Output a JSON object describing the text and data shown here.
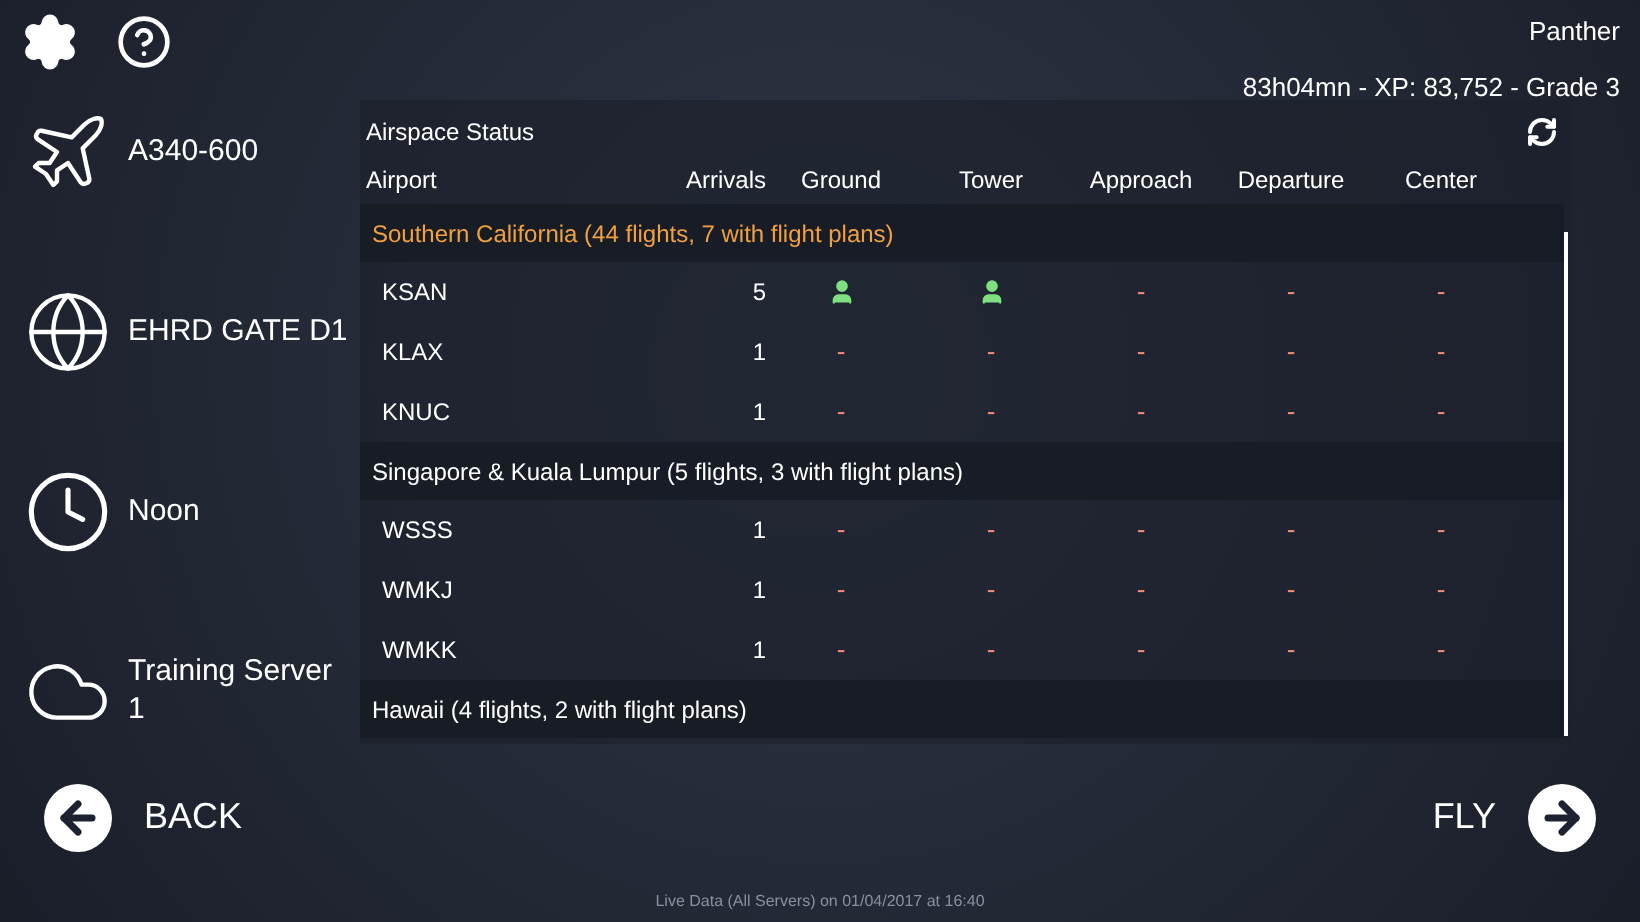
{
  "user": {
    "name": "Panther",
    "stats": "83h04mn - XP: 83,752 - Grade 3"
  },
  "sidebar": [
    {
      "kind": "aircraft",
      "label": "A340-600"
    },
    {
      "kind": "location",
      "label": "EHRD GATE D1"
    },
    {
      "kind": "time",
      "label": "Noon"
    },
    {
      "kind": "server",
      "label": "Training Server 1"
    }
  ],
  "panel": {
    "title": "Airspace Status",
    "columns": [
      "Airport",
      "Arrivals",
      "Ground",
      "Tower",
      "Approach",
      "Departure",
      "Center"
    ],
    "regions": [
      {
        "label": "Southern California (44 flights, 7 with flight plans)",
        "selected": true,
        "airports": [
          {
            "code": "KSAN",
            "arrivals": "5",
            "cells": [
              {
                "kind": "controller"
              },
              {
                "kind": "controller"
              },
              {
                "kind": "dash",
                "text": "-"
              },
              {
                "kind": "dash",
                "text": "-"
              },
              {
                "kind": "dash",
                "text": "-"
              }
            ]
          },
          {
            "code": "KLAX",
            "arrivals": "1",
            "cells": [
              {
                "kind": "dash",
                "text": "-"
              },
              {
                "kind": "dash",
                "text": "-"
              },
              {
                "kind": "dash",
                "text": "-"
              },
              {
                "kind": "dash",
                "text": "-"
              },
              {
                "kind": "dash",
                "text": "-"
              }
            ]
          },
          {
            "code": "KNUC",
            "arrivals": "1",
            "cells": [
              {
                "kind": "dash",
                "text": "-"
              },
              {
                "kind": "dash",
                "text": "-"
              },
              {
                "kind": "dash",
                "text": "-"
              },
              {
                "kind": "dash",
                "text": "-"
              },
              {
                "kind": "dash",
                "text": "-"
              }
            ]
          }
        ]
      },
      {
        "label": "Singapore & Kuala Lumpur (5 flights, 3 with flight plans)",
        "selected": false,
        "airports": [
          {
            "code": "WSSS",
            "arrivals": "1",
            "cells": [
              {
                "kind": "dash",
                "text": "-"
              },
              {
                "kind": "dash",
                "text": "-"
              },
              {
                "kind": "dash",
                "text": "-"
              },
              {
                "kind": "dash",
                "text": "-"
              },
              {
                "kind": "dash",
                "text": "-"
              }
            ]
          },
          {
            "code": "WMKJ",
            "arrivals": "1",
            "cells": [
              {
                "kind": "dash",
                "text": "-"
              },
              {
                "kind": "dash",
                "text": "-"
              },
              {
                "kind": "dash",
                "text": "-"
              },
              {
                "kind": "dash",
                "text": "-"
              },
              {
                "kind": "dash",
                "text": "-"
              }
            ]
          },
          {
            "code": "WMKK",
            "arrivals": "1",
            "cells": [
              {
                "kind": "dash",
                "text": "-"
              },
              {
                "kind": "dash",
                "text": "-"
              },
              {
                "kind": "dash",
                "text": "-"
              },
              {
                "kind": "dash",
                "text": "-"
              },
              {
                "kind": "dash",
                "text": "-"
              }
            ]
          }
        ]
      },
      {
        "label": "Hawaii (4 flights, 2 with flight plans)",
        "selected": false
      }
    ]
  },
  "back": "BACK",
  "fly": "FLY",
  "footer": "Live Data (All Servers) on 01/04/2017 at 16:40"
}
